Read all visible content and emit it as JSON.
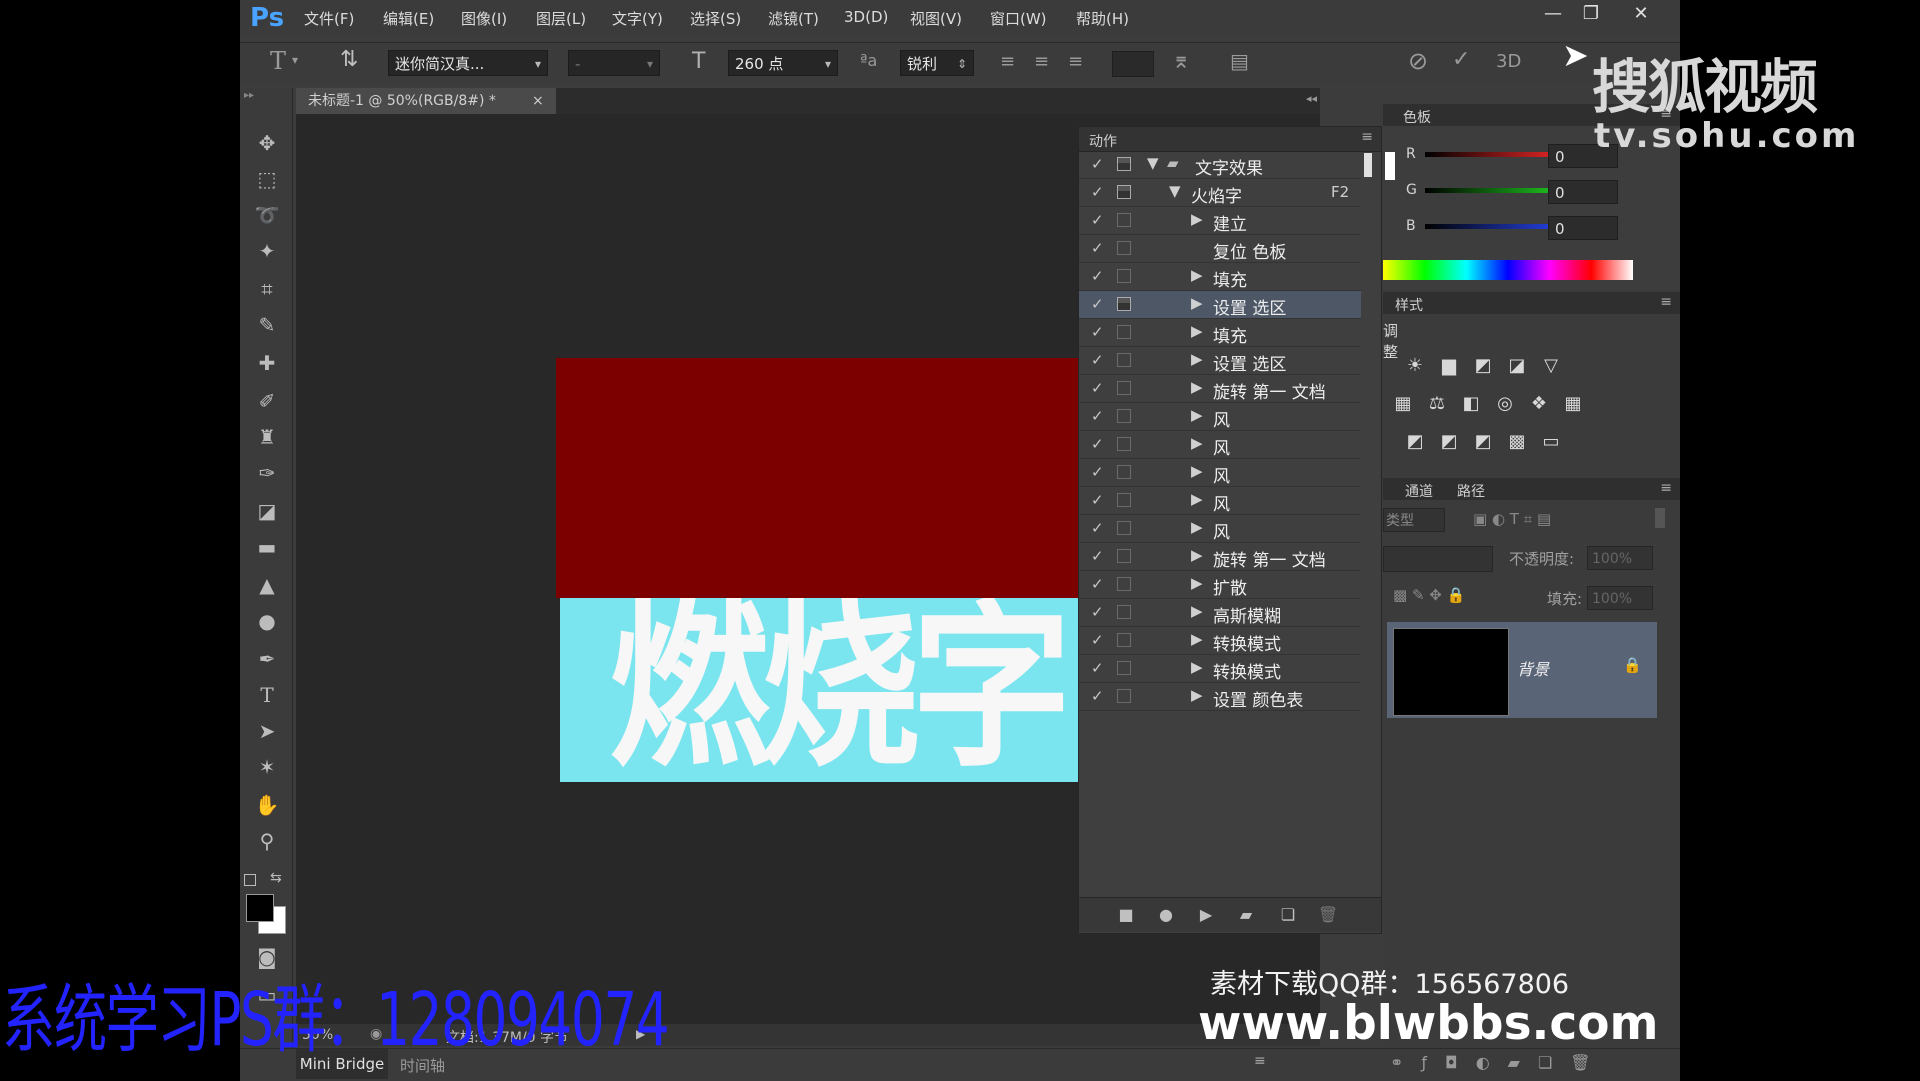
{
  "app": {
    "logo": "Ps",
    "menu": [
      "文件(F)",
      "编辑(E)",
      "图像(I)",
      "图层(L)",
      "文字(Y)",
      "选择(S)",
      "滤镜(T)",
      "3D(D)",
      "视图(V)",
      "窗口(W)",
      "帮助(H)"
    ],
    "window_controls": [
      "minimize",
      "restore",
      "close"
    ]
  },
  "options_bar": {
    "font_family": "迷你简汉真...",
    "font_style": "-",
    "font_size": "260 点",
    "antialias": "锐利",
    "commit_label": "3D"
  },
  "document": {
    "tab_title": "未标题-1 @ 50%(RGB/8#) *",
    "tab_close": "×",
    "canvas_text": "燃烧字",
    "zoom": "50%",
    "doc_info": "文档:1.37M/0 字节",
    "colors": {
      "top_fill": "#7d0000",
      "bottom_fill": "#7ae5ee",
      "text": "#f7f7f7"
    }
  },
  "actions_panel": {
    "title": "动作",
    "rows": [
      {
        "label": "文字效果",
        "level": 0,
        "expanded": true,
        "folder": true,
        "dialog": true
      },
      {
        "label": "火焰字",
        "level": 1,
        "expanded": true,
        "dialog": true,
        "shortcut": "F2"
      },
      {
        "label": "建立",
        "level": 2
      },
      {
        "label": "复位 色板",
        "level": 2,
        "no_arrow": true
      },
      {
        "label": "填充",
        "level": 2
      },
      {
        "label": "设置 选区",
        "level": 2,
        "selected": true,
        "dialog": true
      },
      {
        "label": "填充",
        "level": 2
      },
      {
        "label": "设置 选区",
        "level": 2
      },
      {
        "label": "旋转 第一 文档",
        "level": 2
      },
      {
        "label": "风",
        "level": 2
      },
      {
        "label": "风",
        "level": 2
      },
      {
        "label": "风",
        "level": 2
      },
      {
        "label": "风",
        "level": 2
      },
      {
        "label": "风",
        "level": 2
      },
      {
        "label": "旋转 第一 文档",
        "level": 2
      },
      {
        "label": "扩散",
        "level": 2
      },
      {
        "label": "高斯模糊",
        "level": 2
      },
      {
        "label": "转换模式",
        "level": 2
      },
      {
        "label": "转换模式",
        "level": 2
      },
      {
        "label": "设置 颜色表",
        "level": 2
      }
    ],
    "footer_buttons": [
      "stop",
      "record",
      "play",
      "new-set",
      "new-action",
      "delete"
    ]
  },
  "color_panel": {
    "title": "色板",
    "channels": [
      {
        "name": "R",
        "value": "0",
        "color": "#ff2a2a"
      },
      {
        "name": "G",
        "value": "0",
        "color": "#22dd22"
      },
      {
        "name": "B",
        "value": "0",
        "color": "#2a4aff"
      }
    ]
  },
  "adjustments_panel": {
    "tab": "样式",
    "title": "调整"
  },
  "layers_panel": {
    "tabs": [
      "通道",
      "路径"
    ],
    "kind_label": "类型",
    "opacity_label": "不透明度:",
    "opacity_value": "100%",
    "lock_label": "锁",
    "fill_label": "填充:",
    "fill_value": "100%",
    "layer_name": "背景"
  },
  "bottom_tabs": [
    "Mini Bridge",
    "时间轴"
  ],
  "overlays": {
    "sohu_logo": "搜狐视频",
    "sohu_url": "tv.sohu.com",
    "study_group": "系统学习PS群：128094074",
    "qq_line": "素材下载QQ群：156567806",
    "site": "www.blwbbs.com"
  }
}
